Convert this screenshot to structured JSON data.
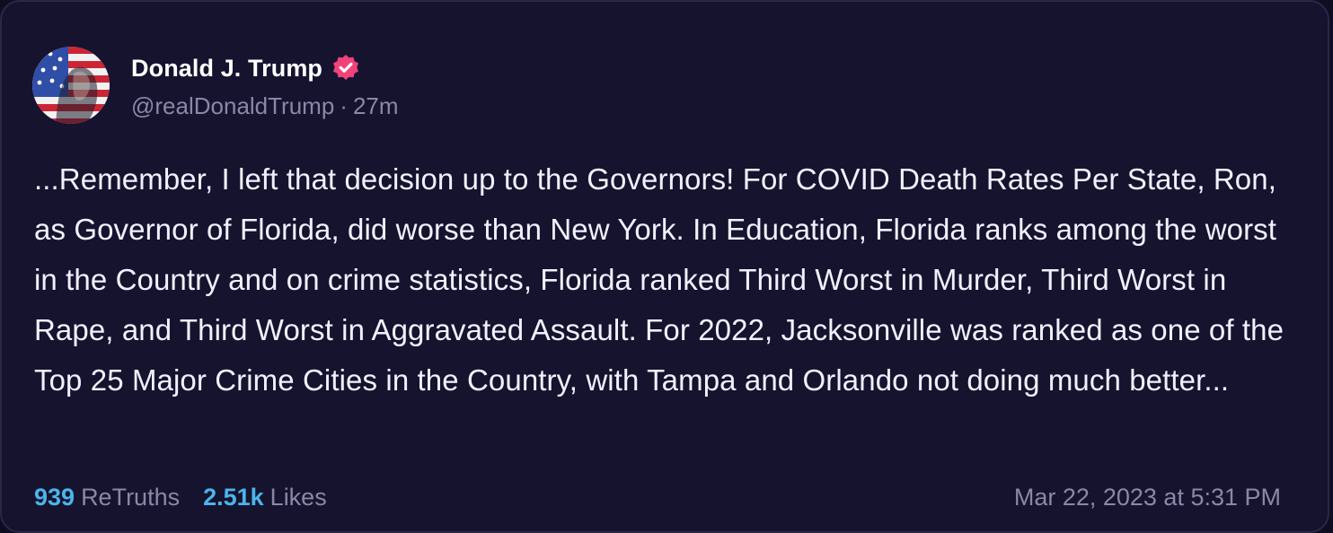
{
  "post": {
    "author": {
      "name": "Donald J. Trump",
      "handle": "@realDonaldTrump",
      "time_ago": "27m",
      "verified_icon": "verified-badge-icon",
      "avatar_icon": "avatar-image"
    },
    "text": "...Remember, I left that decision up to the Governors! For COVID Death Rates Per State, Ron, as Governor of Florida, did worse than New York. In Education, Florida ranks among the worst in the Country and on crime statistics, Florida ranked Third Worst in Murder, Third Worst in Rape, and Third Worst in Aggravated Assault. For 2022, Jacksonville was ranked as one of the Top 25 Major Crime Cities in the Country, with Tampa and Orlando not doing much better...",
    "stats": {
      "retruths_count": "939",
      "retruths_label": "ReTruths",
      "likes_count": "2.51k",
      "likes_label": "Likes"
    },
    "timestamp": "Mar 22, 2023 at 5:31 PM"
  },
  "colors": {
    "background": "#16132f",
    "accent": "#4bb4ea",
    "verified": "#f0437a",
    "muted_text": "#8b87a6"
  }
}
